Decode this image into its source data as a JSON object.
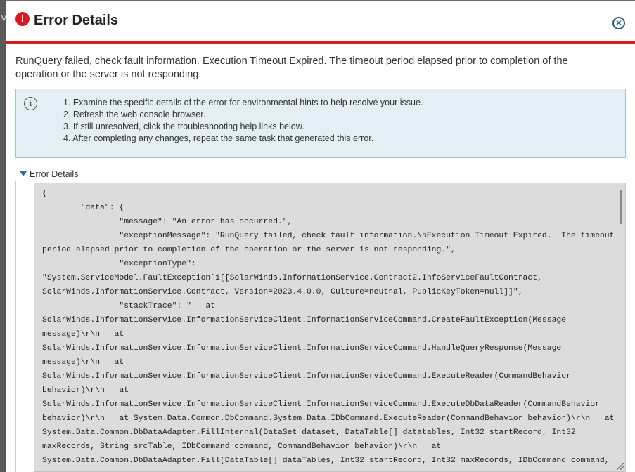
{
  "background": {
    "edge_letter": "M"
  },
  "dialog": {
    "title": "Error Details",
    "error_icon": "!",
    "close_icon": "×",
    "accent_color": "#d71920"
  },
  "message": "RunQuery failed, check fault information. Execution Timeout Expired. The timeout period elapsed prior to completion of the operation or the server is not responding.",
  "info": {
    "icon": "i",
    "steps": [
      "1. Examine the specific details of the error for environmental hints to help resolve your issue.",
      "2. Refresh the web console browser.",
      "3. If still unresolved, click the troubleshooting help links below.",
      "4. After completing any changes, repeat the same task that generated this error."
    ]
  },
  "details": {
    "toggle_label": "Error Details",
    "code": "{\n        \"data\": {\n                \"message\": \"An error has occurred.\",\n                \"exceptionMessage\": \"RunQuery failed, check fault information.\\nExecution Timeout Expired.  The timeout period elapsed prior to completion of the operation or the server is not responding.\",\n                \"exceptionType\": \"System.ServiceModel.FaultException`1[[SolarWinds.InformationService.Contract2.InfoServiceFaultContract, SolarWinds.InformationService.Contract, Version=2023.4.0.0, Culture=neutral, PublicKeyToken=null]]\",\n                \"stackTrace\": \"   at SolarWinds.InformationService.InformationServiceClient.InformationServiceCommand.CreateFaultException(Message message)\\r\\n   at SolarWinds.InformationService.InformationServiceClient.InformationServiceCommand.HandleQueryResponse(Message message)\\r\\n   at SolarWinds.InformationService.InformationServiceClient.InformationServiceCommand.ExecuteReader(CommandBehavior behavior)\\r\\n   at SolarWinds.InformationService.InformationServiceClient.InformationServiceCommand.ExecuteDbDataReader(CommandBehavior behavior)\\r\\n   at System.Data.Common.DbCommand.System.Data.IDbCommand.ExecuteReader(CommandBehavior behavior)\\r\\n   at System.Data.Common.DbDataAdapter.FillInternal(DataSet dataset, DataTable[] datatables, Int32 startRecord, Int32 maxRecords, String srcTable, IDbCommand command, CommandBehavior behavior)\\r\\n   at System.Data.Common.DbDataAdapter.Fill(DataTable[] dataTables, Int32 startRecord, Int32 maxRecords, IDbCommand command,"
  }
}
